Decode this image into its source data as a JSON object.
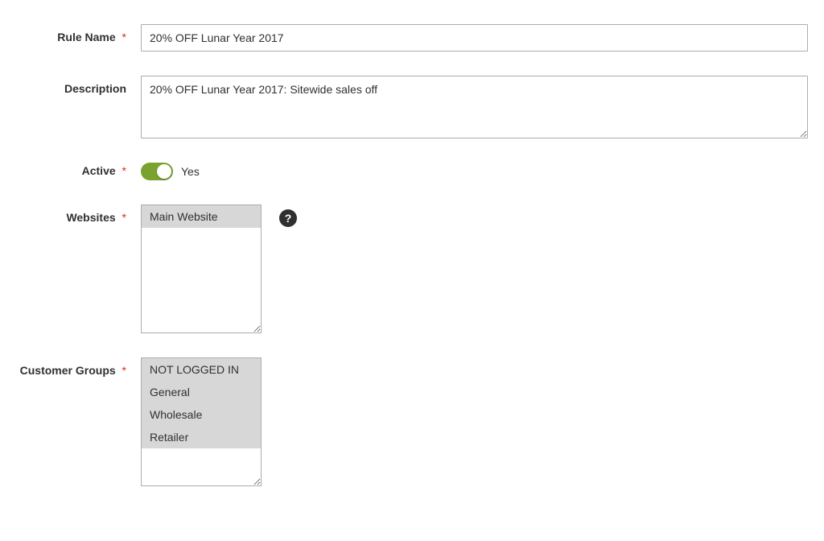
{
  "ruleName": {
    "label": "Rule Name",
    "value": "20% OFF Lunar Year 2017"
  },
  "description": {
    "label": "Description",
    "value": "20% OFF Lunar Year 2017: Sitewide sales off"
  },
  "active": {
    "label": "Active",
    "stateLabel": "Yes",
    "enabled": true
  },
  "websites": {
    "label": "Websites",
    "options": [
      {
        "label": "Main Website",
        "selected": true
      }
    ]
  },
  "customerGroups": {
    "label": "Customer Groups",
    "options": [
      {
        "label": "NOT LOGGED IN",
        "selected": true
      },
      {
        "label": "General",
        "selected": true
      },
      {
        "label": "Wholesale",
        "selected": true
      },
      {
        "label": "Retailer",
        "selected": true
      }
    ]
  },
  "helpIconGlyph": "?"
}
